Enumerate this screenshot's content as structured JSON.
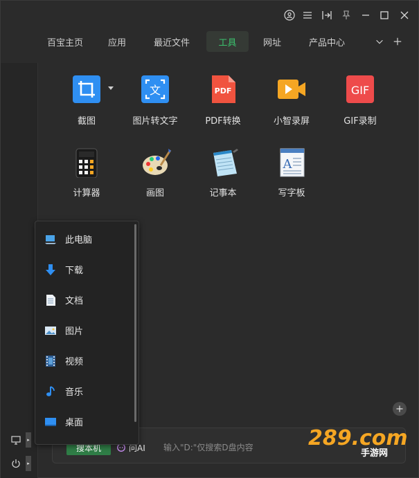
{
  "tabs": {
    "items": [
      {
        "label": "百宝主页"
      },
      {
        "label": "应用"
      },
      {
        "label": "最近文件"
      },
      {
        "label": "工具"
      },
      {
        "label": "网址"
      },
      {
        "label": "产品中心"
      }
    ],
    "active": "工具"
  },
  "tools": [
    {
      "label": "截图",
      "icon": "crop-icon"
    },
    {
      "label": "图片转文字",
      "icon": "image-to-text-icon"
    },
    {
      "label": "PDF转换",
      "icon": "pdf-icon"
    },
    {
      "label": "小智录屏",
      "icon": "screen-record-icon"
    },
    {
      "label": "GIF录制",
      "icon": "gif-icon"
    },
    {
      "label": "计算器",
      "icon": "calculator-icon"
    },
    {
      "label": "画图",
      "icon": "paint-palette-icon"
    },
    {
      "label": "记事本",
      "icon": "notepad-icon"
    },
    {
      "label": "写字板",
      "icon": "wordpad-icon"
    }
  ],
  "tool_icon_text": {
    "image_to_text": "文",
    "pdf": "PDF",
    "gif": "GIF"
  },
  "panel": {
    "items": [
      {
        "label": "此电脑",
        "icon": "computer-icon"
      },
      {
        "label": "下载",
        "icon": "download-icon"
      },
      {
        "label": "文档",
        "icon": "document-icon"
      },
      {
        "label": "图片",
        "icon": "picture-icon"
      },
      {
        "label": "视频",
        "icon": "video-icon"
      },
      {
        "label": "音乐",
        "icon": "music-icon"
      },
      {
        "label": "桌面",
        "icon": "desktop-icon"
      }
    ]
  },
  "search": {
    "tab_a": "搜本机",
    "tab_b": "问AI",
    "placeholder": "输入\"D:\"仅搜索D盘内容"
  },
  "watermark": {
    "text": "289.com",
    "subtext": "手游网"
  },
  "colors": {
    "accent": "#3cc36e",
    "background": "#2b2b2b",
    "panel": "#232323"
  }
}
